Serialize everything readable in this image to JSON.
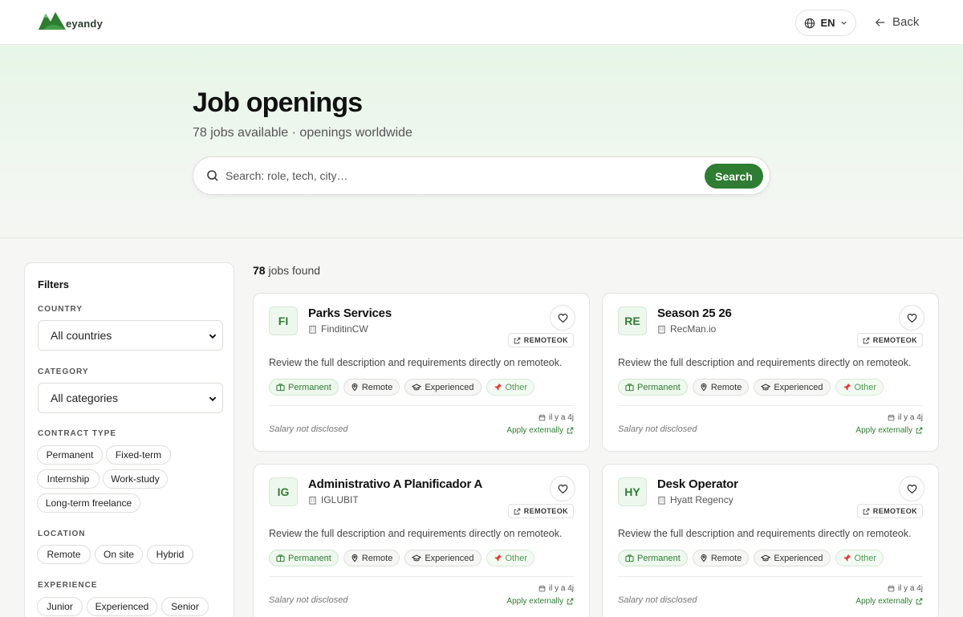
{
  "header": {
    "logo_text": "eyandy",
    "language": "EN",
    "back_label": "Back"
  },
  "hero": {
    "title": "Job openings",
    "subtitle": "78 jobs available · openings worldwide",
    "search_placeholder": "Search: role, tech, city…",
    "search_button": "Search"
  },
  "filters": {
    "title": "Filters",
    "country_label": "Country",
    "country_value": "All countries",
    "category_label": "Category",
    "category_value": "All categories",
    "contract_label": "Contract type",
    "contract_options": [
      "Permanent",
      "Fixed-term",
      "Internship",
      "Work-study",
      "Long-term freelance"
    ],
    "location_label": "Location",
    "location_options": [
      "Remote",
      "On site",
      "Hybrid"
    ],
    "experience_label": "Experience",
    "experience_options": [
      "Junior",
      "Experienced",
      "Senior"
    ]
  },
  "results": {
    "count": "78",
    "count_suffix": "jobs found"
  },
  "jobs": [
    {
      "initials": "FI",
      "title": "Parks Services",
      "company": "FinditinCW",
      "source": "REMOTEOK",
      "description": "Review the full description and requirements directly on remoteok.",
      "tags": [
        "Permanent",
        "Remote",
        "Experienced",
        "Other"
      ],
      "salary": "Salary not disclosed",
      "date": "il y a 4j",
      "apply": "Apply externally"
    },
    {
      "initials": "RE",
      "title": "Season 25 26",
      "company": "RecMan.io",
      "source": "REMOTEOK",
      "description": "Review the full description and requirements directly on remoteok.",
      "tags": [
        "Permanent",
        "Remote",
        "Experienced",
        "Other"
      ],
      "salary": "Salary not disclosed",
      "date": "il y a 4j",
      "apply": "Apply externally"
    },
    {
      "initials": "IG",
      "title": "Administrativo A Planificador A",
      "company": "IGLUBIT",
      "source": "REMOTEOK",
      "description": "Review the full description and requirements directly on remoteok.",
      "tags": [
        "Permanent",
        "Remote",
        "Experienced",
        "Other"
      ],
      "salary": "Salary not disclosed",
      "date": "il y a 4j",
      "apply": "Apply externally"
    },
    {
      "initials": "HY",
      "title": "Desk Operator",
      "company": "Hyatt Regency",
      "source": "REMOTEOK",
      "description": "Review the full description and requirements directly on remoteok.",
      "tags": [
        "Permanent",
        "Remote",
        "Experienced",
        "Other"
      ],
      "salary": "Salary not disclosed",
      "date": "il y a 4j",
      "apply": "Apply externally"
    }
  ],
  "colors": {
    "accent": "#2e7d32",
    "hero_bg": "#e6f6e7",
    "page_bg": "#f6f7f4"
  },
  "icons": {
    "language": "globe-icon",
    "back": "arrow-left-icon",
    "search": "search-icon",
    "company": "building-icon",
    "favorite": "heart-icon",
    "source": "external-link-icon",
    "tag_permanent": "briefcase-icon",
    "tag_remote": "map-pin-icon",
    "tag_experienced": "graduation-cap-icon",
    "tag_other": "pushpin-icon",
    "date": "calendar-icon"
  }
}
